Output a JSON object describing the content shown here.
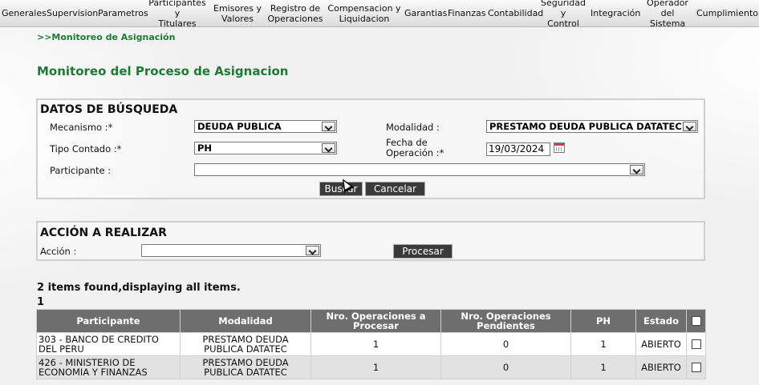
{
  "menu": [
    {
      "label": "Generales"
    },
    {
      "label": "Supervision"
    },
    {
      "label": "Parametros"
    },
    {
      "label": "Participantes y\nTitulares"
    },
    {
      "label": "Emisores y\nValores"
    },
    {
      "label": "Registro de\nOperaciones"
    },
    {
      "label": "Compensacion y\nLiquidacion"
    },
    {
      "label": "Garantias"
    },
    {
      "label": "Finanzas"
    },
    {
      "label": "Contabilidad"
    },
    {
      "label": "Seguridad y\nControl"
    },
    {
      "label": "Integración"
    },
    {
      "label": "Operador\ndel Sistema"
    },
    {
      "label": "Cumplimiento"
    }
  ],
  "breadcrumb": ">>Monitoreo de Asignación",
  "page_title": "Monitoreo del Proceso de Asignacion",
  "search": {
    "title": "DATOS DE BÚSQUEDA",
    "mecanismo_label": "Mecanismo :*",
    "mecanismo_value": "DEUDA PUBLICA",
    "modalidad_label": "Modalidad :",
    "modalidad_value": "PRESTAMO DEUDA PUBLICA DATATEC",
    "tipo_contado_label": "Tipo Contado :*",
    "tipo_contado_value": "PH",
    "fecha_label_1": "Fecha de",
    "fecha_label_2": "Operación :*",
    "fecha_value": "19/03/2024",
    "participante_label": "Participante :",
    "participante_value": "",
    "buscar_label": "Buscar",
    "cancelar_label": "Cancelar"
  },
  "action": {
    "title": "ACCIÓN A REALIZAR",
    "accion_label": "Acción :",
    "accion_value": "",
    "procesar_label": "Procesar"
  },
  "results": {
    "summary": "2 items found,displaying all items.",
    "page": "1",
    "headers": {
      "participante": "Participante",
      "modalidad": "Modalidad",
      "nro_procesar": "Nro. Operaciones a Procesar",
      "nro_pendientes": "Nro. Operaciones Pendientes",
      "ph": "PH",
      "estado": "Estado"
    },
    "rows": [
      {
        "participante": "303 - BANCO DE CREDITO DEL PERU",
        "modalidad": "PRESTAMO DEUDA PUBLICA DATATEC",
        "nro_procesar": "1",
        "nro_pendientes": "0",
        "ph": "1",
        "estado": "ABIERTO"
      },
      {
        "participante": "426 - MINISTERIO DE ECONOMIA Y FINANZAS",
        "modalidad": "PRESTAMO DEUDA PUBLICA DATATEC",
        "nro_procesar": "1",
        "nro_pendientes": "0",
        "ph": "1",
        "estado": "ABIERTO"
      }
    ]
  }
}
